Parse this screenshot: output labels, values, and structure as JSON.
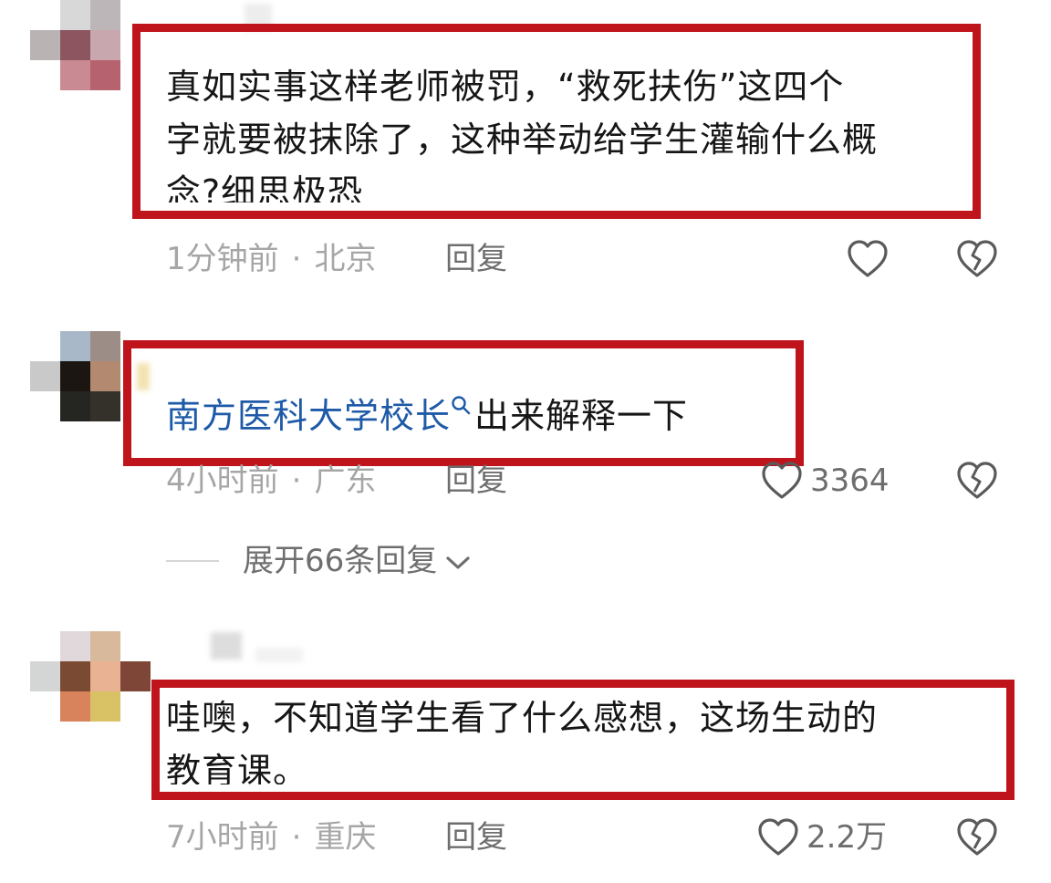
{
  "comments": [
    {
      "text_lines": [
        "真如实事这样老师被罚，“救死扶伤”这四个",
        "字就要被抹除了，这种举动给学生灌输什么概",
        "念?细思极恐"
      ],
      "time": "1分钟前",
      "location": "北京",
      "reply_label": "回复",
      "like_count": ""
    },
    {
      "link_text": "南方医科大学校长",
      "text_rest": "出来解释一下",
      "time": "4小时前",
      "location": "广东",
      "reply_label": "回复",
      "like_count": "3364",
      "expand_label": "展开66条回复"
    },
    {
      "text_lines": [
        "哇噢，不知道学生看了什么感想，这场生动的",
        "教育课。"
      ],
      "time": "7小时前",
      "location": "重庆",
      "reply_label": "回复",
      "like_count": "2.2万"
    }
  ],
  "meta_separator": "·",
  "colors": {
    "highlight_box": "#c0141c",
    "link": "#1e5aa8",
    "meta_text": "#a6a6a6",
    "action_text": "#6e6e6e"
  },
  "icons": {
    "like": "heart-outline-icon",
    "dislike": "broken-heart-icon",
    "search": "search-icon",
    "expand": "chevron-down-icon"
  }
}
